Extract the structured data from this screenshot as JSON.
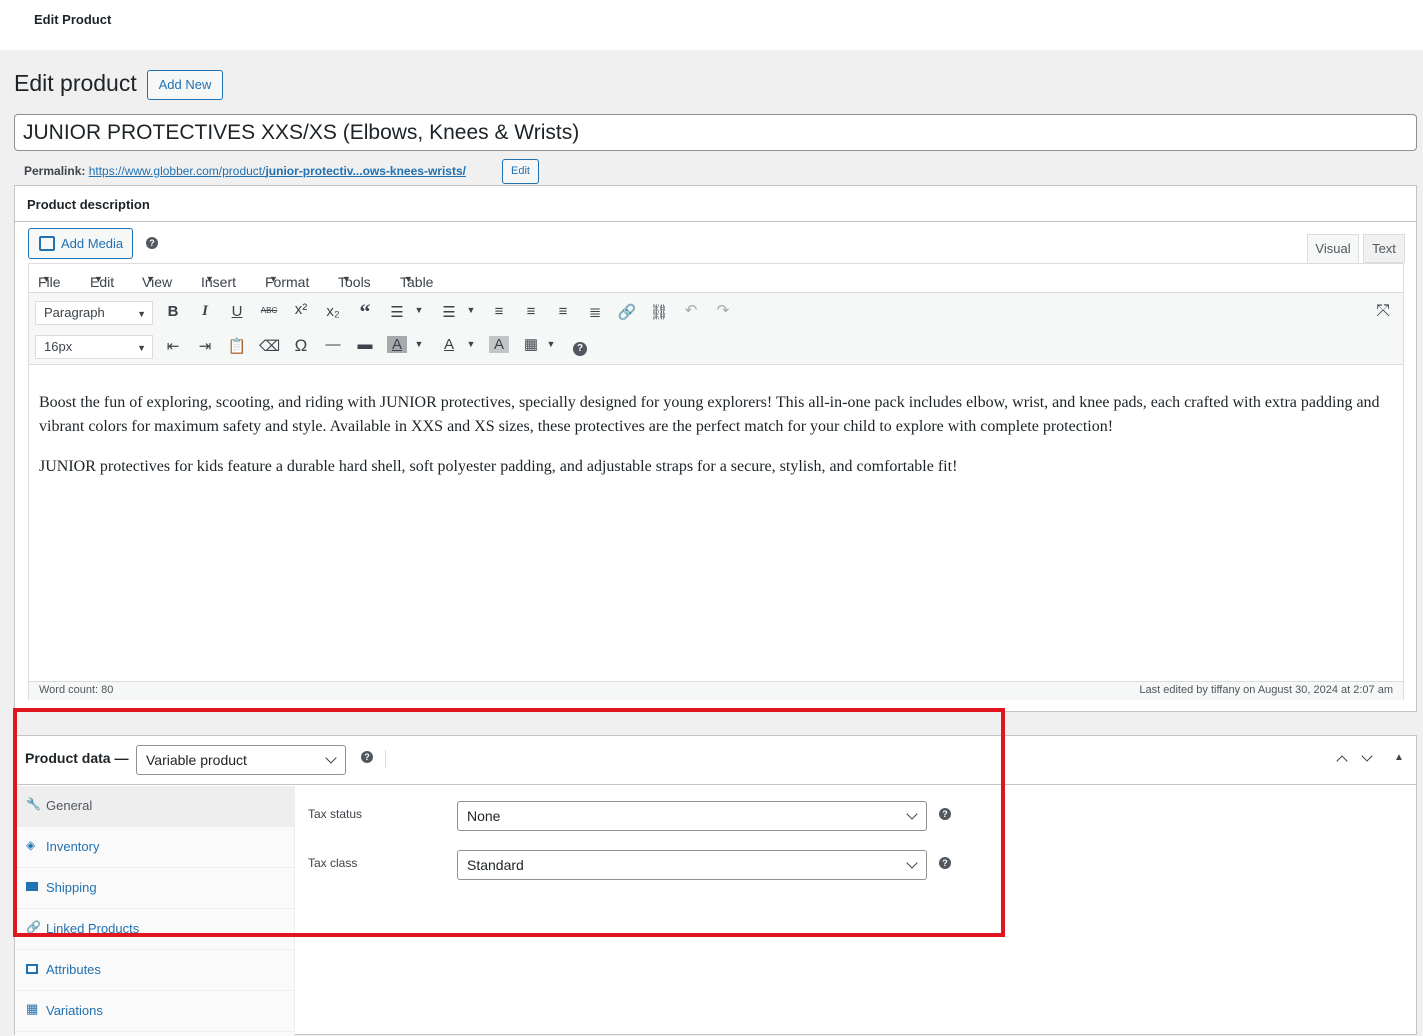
{
  "topbar": {
    "title": "Edit Product"
  },
  "header": {
    "title": "Edit product",
    "add_new": "Add New"
  },
  "title_input": {
    "value": "JUNIOR PROTECTIVES XXS/XS (Elbows, Knees & Wrists)"
  },
  "permalink": {
    "label": "Permalink:",
    "url_base": "https://www.globber.com/product/",
    "url_slug": "junior-protectiv...ows-knees-wrists/",
    "edit": "Edit"
  },
  "description": {
    "heading": "Product description",
    "add_media": "Add Media",
    "tab_visual": "Visual",
    "tab_text": "Text",
    "menu": {
      "file": "File",
      "edit": "Edit",
      "view": "View",
      "insert": "Insert",
      "format": "Format",
      "tools": "Tools",
      "table": "Table"
    },
    "format_select": "Paragraph",
    "size_select": "16px",
    "paragraphs": [
      "Boost the fun of exploring, scooting, and riding with JUNIOR protectives, specially designed for young explorers! This all-in-one pack includes elbow, wrist, and knee pads, each crafted with extra padding and vibrant colors for maximum safety and style. Available in XXS and XS sizes, these protectives are the perfect match for your child to explore with complete protection!",
      "JUNIOR protectives for kids feature a durable hard shell, soft polyester padding, and adjustable straps for a secure, stylish, and comfortable fit!"
    ],
    "word_count": "Word count: 80",
    "last_edited": "Last edited by tiffany on August 30, 2024 at 2:07 am"
  },
  "product_data": {
    "title": "Product data —",
    "type_select": "Variable product",
    "tabs": [
      "General",
      "Inventory",
      "Shipping",
      "Linked Products",
      "Attributes",
      "Variations"
    ],
    "tax_status_label": "Tax status",
    "tax_status_value": "None",
    "tax_class_label": "Tax class",
    "tax_class_value": "Standard"
  },
  "colors": {
    "accent": "#2271b1",
    "highlight": "#e0151f"
  }
}
